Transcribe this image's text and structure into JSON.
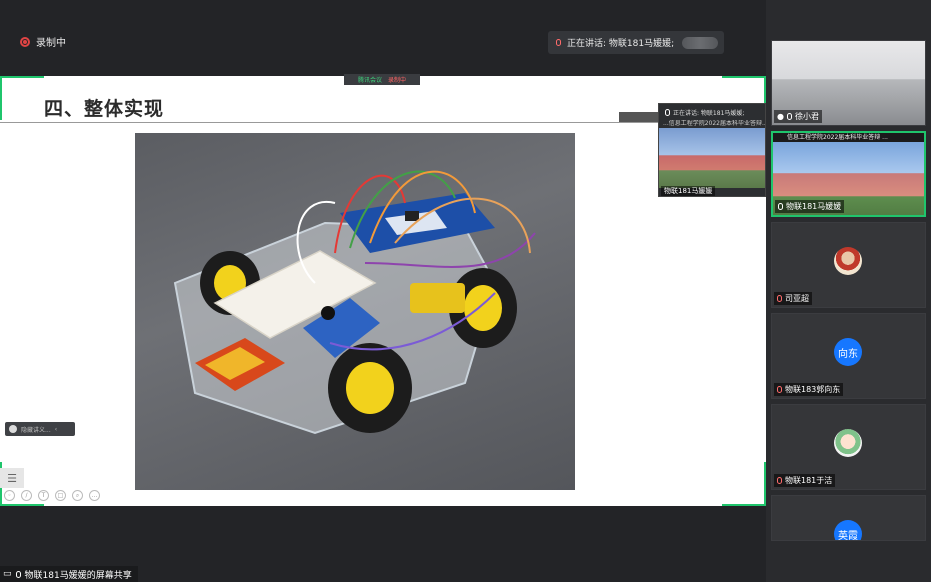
{
  "recording": {
    "label": "录制中"
  },
  "speaking": {
    "label": "正在讲话: 物联181马媛媛;"
  },
  "slide": {
    "tag_left": "腾讯会议",
    "tag_right": "录制中",
    "title": "四、整体实现",
    "toggle_label": "隐藏讲义...",
    "list_icon": "☰"
  },
  "floating_cam": {
    "header": "正在讲话: 物联181马媛媛;",
    "banner": "...信息工程学院2022届本科毕业答辩...",
    "name": "物联181马媛媛"
  },
  "share_label": "物联181马媛媛的屏幕共享",
  "gallery": [
    {
      "name": "徐小君",
      "type": "room"
    },
    {
      "name": "物联181马媛媛",
      "type": "school",
      "banner": "信息工程学院2022届本科毕业答辩 ...",
      "active": true
    },
    {
      "name": "司亚超",
      "type": "photo"
    },
    {
      "name": "物联183郭向东",
      "type": "blue",
      "initials": "向东"
    },
    {
      "name": "物联181于洁",
      "type": "cartoon"
    },
    {
      "name": "",
      "type": "blue",
      "initials": "英霞"
    }
  ],
  "colors": {
    "accent": "#1fc56c",
    "record": "#e04444",
    "avatar_blue": "#1677ff"
  }
}
